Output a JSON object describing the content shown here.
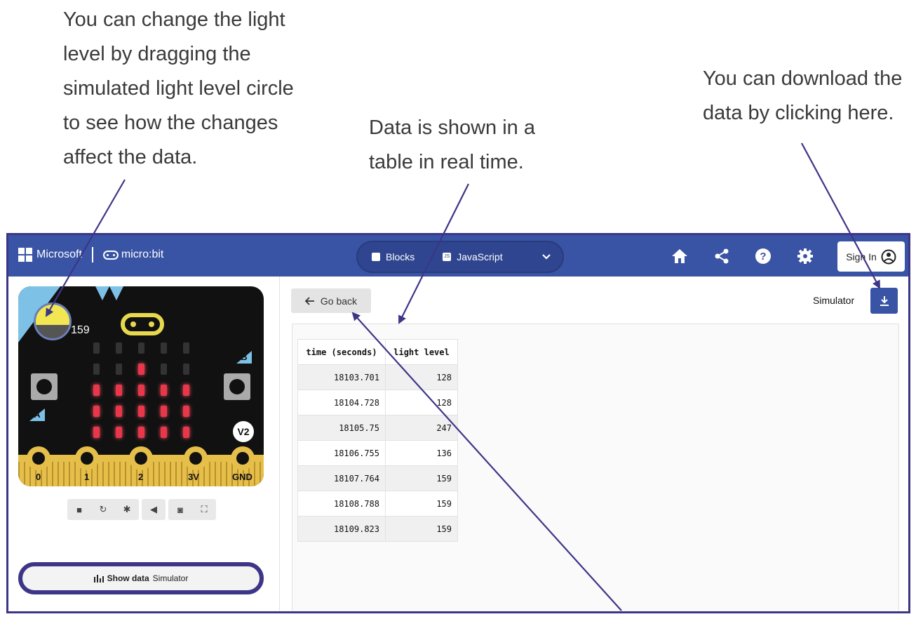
{
  "annotations": {
    "light_level": "You can change the light level by dragging the simulated light level circle to see how the changes affect the data.",
    "table": "Data is shown in a table in real time.",
    "download": "You can download the data by clicking here."
  },
  "header": {
    "brand": "Microsoft",
    "product": "micro:bit",
    "tabs": [
      {
        "label": "Blocks",
        "icon": "puzzle-icon"
      },
      {
        "label": "JavaScript",
        "icon": "js-icon"
      }
    ],
    "sign_in": "Sign In"
  },
  "simulator": {
    "light_level": "159",
    "button_a": "A",
    "button_b": "B",
    "version": "V2",
    "pins": [
      "0",
      "1",
      "2",
      "3V",
      "GND"
    ],
    "show_data_label": "Show data",
    "show_data_source": "Simulator"
  },
  "data_view": {
    "go_back": "Go back",
    "source_label": "Simulator",
    "table": {
      "columns": [
        "time (seconds)",
        "light level"
      ],
      "rows": [
        [
          "18103.701",
          "128"
        ],
        [
          "18104.728",
          "128"
        ],
        [
          "18105.75",
          "247"
        ],
        [
          "18106.755",
          "136"
        ],
        [
          "18107.764",
          "159"
        ],
        [
          "18108.788",
          "159"
        ],
        [
          "18109.823",
          "159"
        ]
      ]
    }
  },
  "colors": {
    "header_bg": "#3954a5",
    "annotation_line": "#3d3587",
    "led_on": "#e8374b"
  }
}
